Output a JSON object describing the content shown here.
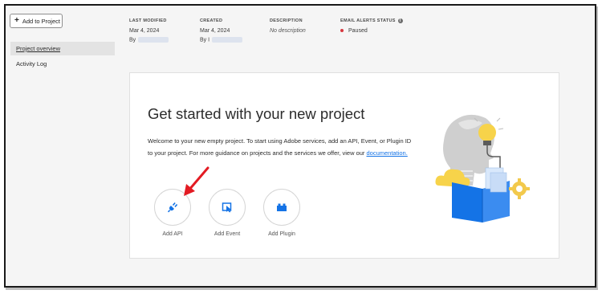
{
  "sidebar": {
    "add_button_label": "Add to Project",
    "items": [
      {
        "label": "Project overview",
        "active": true
      },
      {
        "label": "Activity Log",
        "active": false
      }
    ]
  },
  "meta": {
    "last_modified": {
      "label": "LAST MODIFIED",
      "date": "Mar 4, 2024",
      "by": "By"
    },
    "created": {
      "label": "CREATED",
      "date": "Mar 4, 2024",
      "by": "By I"
    },
    "description": {
      "label": "DESCRIPTION",
      "value": "No description"
    },
    "email_alerts": {
      "label": "EMAIL ALERTS STATUS",
      "value": "Paused",
      "info_icon": "info-icon",
      "status_color": "#d7373f"
    }
  },
  "card": {
    "title": "Get started with your new project",
    "description": "Welcome to your new empty project. To start using Adobe services, add an API, Event, or Plugin ID to your project. For more guidance on projects and the services we offer, view our ",
    "link_text": "documentation.",
    "actions": [
      {
        "label": "Add API",
        "icon": "plug-icon"
      },
      {
        "label": "Add Event",
        "icon": "event-icon"
      },
      {
        "label": "Add Plugin",
        "icon": "plugin-icon"
      }
    ]
  },
  "colors": {
    "accent": "#1473e6",
    "annotation_arrow": "#e31b23",
    "icon_blue": "#1473e6"
  }
}
